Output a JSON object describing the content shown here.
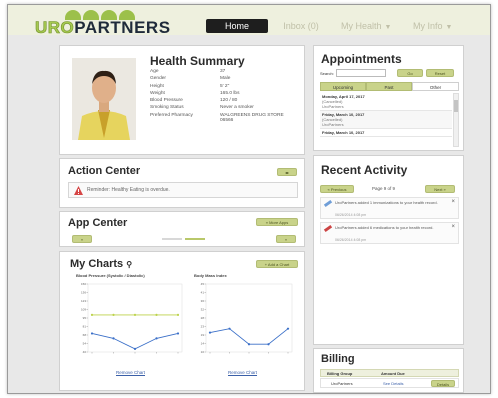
{
  "header": {
    "logo_uro": "URO",
    "logo_partners": "PARTNERS",
    "nav": {
      "home": "Home",
      "inbox": "Inbox (0)",
      "my_health": "My Health",
      "my_info": "My Info"
    }
  },
  "health_summary": {
    "title": "Health Summary",
    "fields": [
      {
        "label": "Age",
        "value": "37"
      },
      {
        "label": "Gender",
        "value": "Male"
      },
      {
        "label": "Height",
        "value": "5' 2\""
      },
      {
        "label": "Weight",
        "value": "165.0 lbs"
      },
      {
        "label": "Blood Pressure",
        "value": "120 / 80"
      },
      {
        "label": "Smoking Status",
        "value": "Never a smoker"
      },
      {
        "label": "Preferred Pharmacy",
        "value": "WALGREENS DRUG STORE 06566"
      }
    ]
  },
  "action_center": {
    "title": "Action Center",
    "reminder": "Reminder: Healthy Eating is overdue."
  },
  "app_center": {
    "title": "App Center",
    "more_apps": "» More Apps",
    "prev": "«",
    "next": "»"
  },
  "my_charts": {
    "title": "My Charts",
    "add_chart": "+ Add a Chart",
    "remove_chart": "Remove Chart"
  },
  "chart_data": [
    {
      "type": "line",
      "title": "Blood Pressure (Systolic / Diastolic)",
      "series": [
        {
          "values": [
            100,
            100,
            100,
            100,
            100
          ],
          "color": "#bcd24a"
        },
        {
          "values": [
            70,
            62,
            45,
            62,
            70
          ],
          "color": "#3a6fc8"
        }
      ],
      "ylim": [
        40,
        150
      ]
    },
    {
      "type": "line",
      "title": "Body Mass Index",
      "series": [
        {
          "values": [
            20,
            22,
            14,
            14,
            22
          ],
          "color": "#3a6fc8"
        }
      ],
      "ylim": [
        10,
        45
      ]
    }
  ],
  "appointments": {
    "title": "Appointments",
    "search_label": "Search:",
    "filter_buttons": [
      "Go",
      "Reset"
    ],
    "tabs": [
      "Upcoming",
      "Past",
      "Other"
    ],
    "items": [
      {
        "date": "Monday, April 17, 2017",
        "detail": "(Cancelled)",
        "provider": "UroPartners"
      },
      {
        "date": "Friday, March 10, 2017",
        "detail": "(Cancelled)",
        "provider": "UroPartners"
      },
      {
        "date": "Friday, March 10, 2017",
        "detail": "",
        "provider": ""
      }
    ]
  },
  "recent_activity": {
    "title": "Recent Activity",
    "prev": "« Previous",
    "page": "Page 9 of 9",
    "next": "Next »",
    "items": [
      {
        "text": "UroPartners added 1 immunizations to your health record.",
        "time": "06/26/2014 4:08 pm"
      },
      {
        "text": "UroPartners added 6 medications to your health record.",
        "time": "06/26/2014 4:08 pm"
      }
    ]
  },
  "billing": {
    "title": "Billing",
    "columns": [
      "Billing Group",
      "Amount Due"
    ],
    "rows": [
      {
        "group": "UroPartners",
        "amount": "See Details",
        "action": "Details"
      }
    ]
  }
}
